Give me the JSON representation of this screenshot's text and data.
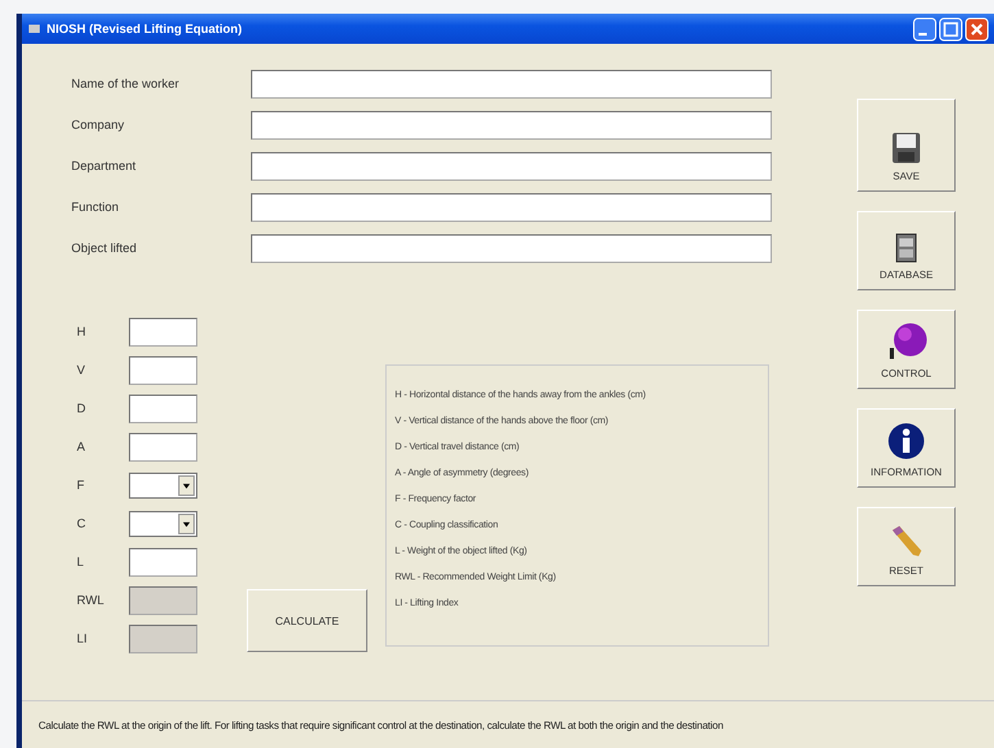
{
  "window": {
    "title": "NIOSH (Revised Lifting Equation)"
  },
  "worker_fields": [
    {
      "label": "Name of the worker"
    },
    {
      "label": "Company"
    },
    {
      "label": "Department"
    },
    {
      "label": "Function"
    },
    {
      "label": "Object lifted"
    }
  ],
  "parameters": [
    {
      "label": "H",
      "kind": "text"
    },
    {
      "label": "V",
      "kind": "text"
    },
    {
      "label": "D",
      "kind": "text"
    },
    {
      "label": "A",
      "kind": "text"
    },
    {
      "label": "F",
      "kind": "dropdown"
    },
    {
      "label": "C",
      "kind": "dropdown"
    },
    {
      "label": "L",
      "kind": "text"
    },
    {
      "label": "RWL",
      "kind": "readonly"
    },
    {
      "label": "LI",
      "kind": "readonly"
    }
  ],
  "calculate_button": "CALCULATE",
  "legend": [
    "H - Horizontal distance of the hands away from the ankles (cm)",
    "V - Vertical distance of the hands above the floor (cm)",
    "D - Vertical travel distance (cm)",
    "A - Angle of asymmetry (degrees)",
    "F - Frequency factor",
    "C - Coupling classification",
    "L - Weight of the object lifted (Kg)",
    "RWL - Recommended Weight Limit (Kg)",
    "LI - Lifting Index"
  ],
  "side_buttons": [
    {
      "label": "SAVE",
      "kind": "save"
    },
    {
      "label": "DATABASE",
      "kind": "database"
    },
    {
      "label": "CONTROL",
      "kind": "control"
    },
    {
      "label": "INFORMATION",
      "kind": "information"
    },
    {
      "label": "RESET",
      "kind": "reset"
    }
  ],
  "status_bar": "Calculate the RWL at the origin of the lift. For lifting tasks that require significant control at the destination, calculate the RWL at both the origin and the destination"
}
